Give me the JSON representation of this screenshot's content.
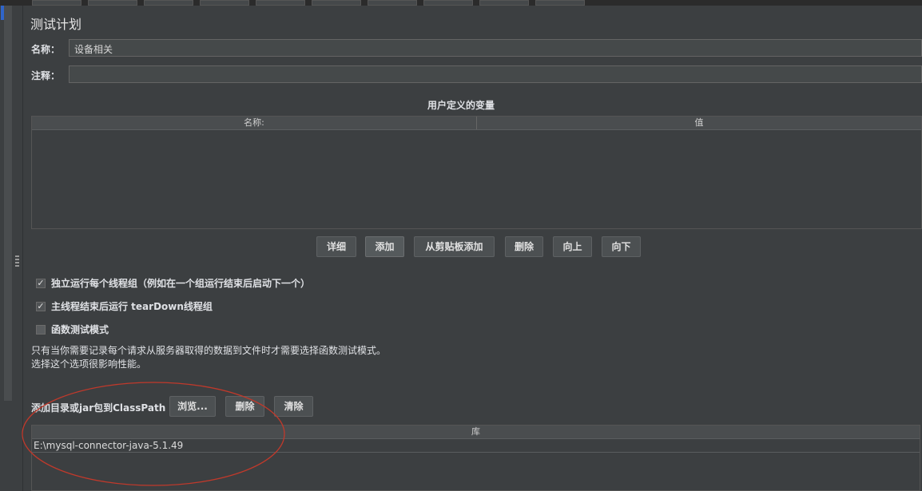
{
  "panel": {
    "title": "测试计划",
    "name_label": "名称：",
    "name_value": "设备相关",
    "comment_label": "注释：",
    "comment_value": ""
  },
  "variables": {
    "section_title": "用户定义的变量",
    "columns": [
      "名称:",
      "值"
    ],
    "rows": []
  },
  "buttons": {
    "detail": "详细",
    "add": "添加",
    "add_clipboard": "从剪贴板添加",
    "delete": "删除",
    "up": "向上",
    "down": "向下"
  },
  "options": [
    {
      "label": "独立运行每个线程组（例如在一个组运行结束后启动下一个）",
      "checked": true
    },
    {
      "label": "主线程结束后运行 tearDown线程组",
      "checked": true
    },
    {
      "label": "函数测试模式",
      "checked": false
    }
  ],
  "note": {
    "line1": "只有当你需要记录每个请求从服务器取得的数据到文件时才需要选择函数测试模式。",
    "line2": "选择这个选项很影响性能。"
  },
  "classpath": {
    "label": "添加目录或jar包到ClassPath",
    "browse": "浏览...",
    "delete": "删除",
    "clear": "清除",
    "column": "库",
    "rows": [
      "E:\\mysql-connector-java-5.1.49"
    ]
  },
  "colors": {
    "background": "#3c3f41",
    "annotation": "#c0392b",
    "scroll_thumb": "#2f65ca"
  }
}
